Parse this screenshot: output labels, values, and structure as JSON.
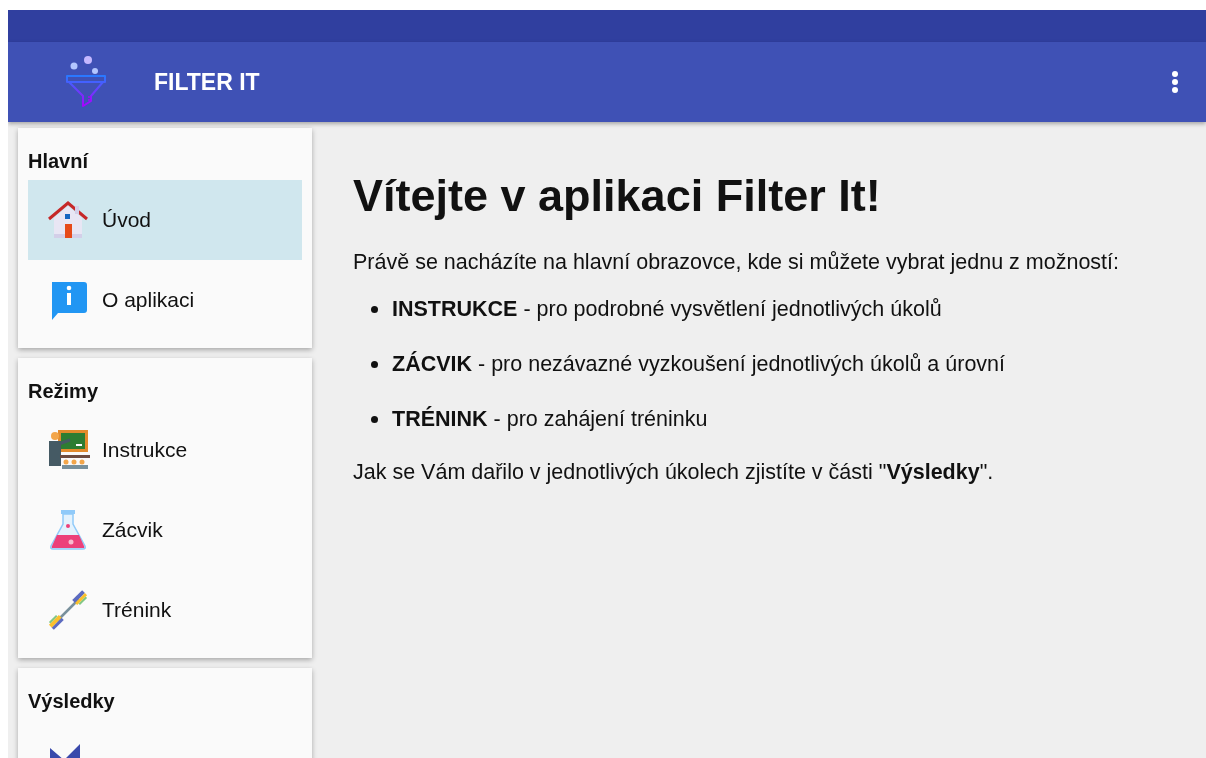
{
  "app_bar": {
    "title": "FILTER IT"
  },
  "sidebar": {
    "sections": [
      {
        "title": "Hlavní",
        "items": [
          {
            "kind": "house",
            "label": "Úvod",
            "selected": true
          },
          {
            "kind": "info",
            "label": "O aplikaci",
            "selected": false
          }
        ]
      },
      {
        "title": "Režimy",
        "items": [
          {
            "kind": "teacher",
            "label": "Instrukce",
            "selected": false
          },
          {
            "kind": "flask",
            "label": "Zácvik",
            "selected": false
          },
          {
            "kind": "dumbbell",
            "label": "Trénink",
            "selected": false
          }
        ]
      },
      {
        "title": "Výsledky",
        "items": [
          {
            "kind": "chart",
            "selected": false
          }
        ]
      }
    ]
  },
  "content": {
    "heading": "Vítejte v aplikaci Filter It!",
    "intro": "Právě se nacházíte na hlavní obrazovce, kde si můžete vybrat jednu z možností:",
    "bullets": [
      "**INSTRUKCE** - pro podrobné vysvětlení jednotlivých úkolů",
      "**ZÁCVIK** - pro nezávazné vyzkoušení jednotlivých úkolů a úrovní",
      "**TRÉNINK** - pro zahájení tréninku"
    ],
    "closing": "Jak se Vám dařilo v jednotlivých úkolech zjistíte v části \"**Výsledky**\"."
  }
}
